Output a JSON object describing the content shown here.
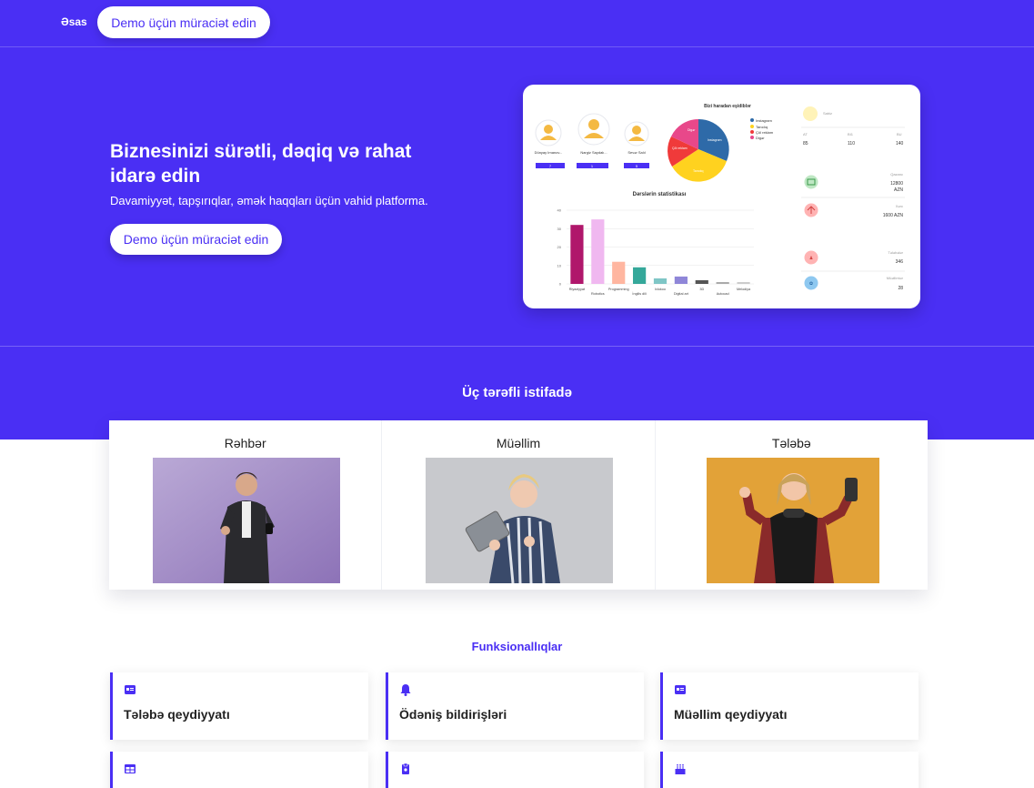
{
  "nav": {
    "home_label": "Əsas",
    "demo_label": "Demo üçün müraciət edin"
  },
  "hero": {
    "title": "Biznesinizi sürətli, dəqiq və rahat idarə edin",
    "subtitle": "Davamiyyət, tapşırıqlar, əmək haqqları üçün vahid platforma.",
    "button_label": "Demo üçün müraciət edin"
  },
  "dashboard": {
    "pie_title": "Bizi haradan eşidiblər",
    "pie_legend": [
      "Instagram",
      "Tanıdıq",
      "Çöl reklam",
      "Digər"
    ],
    "pie_labels": [
      "Digər",
      "Instagram",
      "Çöl reklam",
      "Tanıdıq"
    ],
    "pie_colors": [
      "#e8488a",
      "#2e6aa8",
      "#f03a3a",
      "#ffd21f"
    ],
    "top_students": [
      {
        "name": "Dünyay Imanov...",
        "score": "7"
      },
      {
        "name": "Nargiz Saydalı...",
        "score": "1"
      },
      {
        "name": "Sevər Salıl",
        "score": "5"
      }
    ],
    "chart_data": {
      "type": "bar",
      "title": "Dərslərin statistikası",
      "categories": [
        "Riyaziyyat",
        "Robotics",
        "Programming",
        "İngilis dili",
        "Ixlokoo",
        "Digital art",
        "3D",
        "Autocad",
        "Melodiya"
      ],
      "values": [
        32,
        35,
        12,
        9,
        3,
        4,
        2,
        1,
        1
      ],
      "colors": [
        "#b0176b",
        "#f0b8f0",
        "#ffb6a0",
        "#35a89a",
        "#7fc6c6",
        "#8f86d8",
        "#555555",
        "#aaaaaa",
        "#cccccc"
      ],
      "ylim": [
        0,
        40
      ],
      "yticks": [
        0,
        10,
        20,
        30,
        40
      ]
    },
    "stats_label": "Sabiz",
    "stats": [
      {
        "label": "AT",
        "value": "85"
      },
      {
        "label": "BI1",
        "value": "110"
      },
      {
        "label": "BU",
        "value": "140"
      }
    ],
    "income": {
      "label": "Qazanc",
      "value": "12800",
      "unit": "AZN"
    },
    "expense": {
      "label": "Xərc",
      "value": "1600 AZN"
    },
    "students": {
      "label": "Tələbələr",
      "value": "346"
    },
    "teachers": {
      "label": "Müəllimlər",
      "value": "28"
    }
  },
  "roles": {
    "title": "Üç tərəfli istifadə",
    "items": [
      {
        "label": "Rəhbər"
      },
      {
        "label": "Müəllim"
      },
      {
        "label": "Tələbə"
      }
    ]
  },
  "features": {
    "title": "Funksionallıqlar",
    "items": [
      {
        "label": "Tələbə qeydiyyatı",
        "icon": "id-card-icon"
      },
      {
        "label": "Ödəniş bildirişləri",
        "icon": "bell-icon"
      },
      {
        "label": "Müəllim qeydiyyatı",
        "icon": "id-card-icon"
      },
      {
        "label": "",
        "icon": "table-icon"
      },
      {
        "label": "",
        "icon": "clipboard-icon"
      },
      {
        "label": "",
        "icon": "cake-icon"
      }
    ]
  },
  "colors": {
    "brand": "#4a2ff4",
    "white": "#ffffff"
  }
}
